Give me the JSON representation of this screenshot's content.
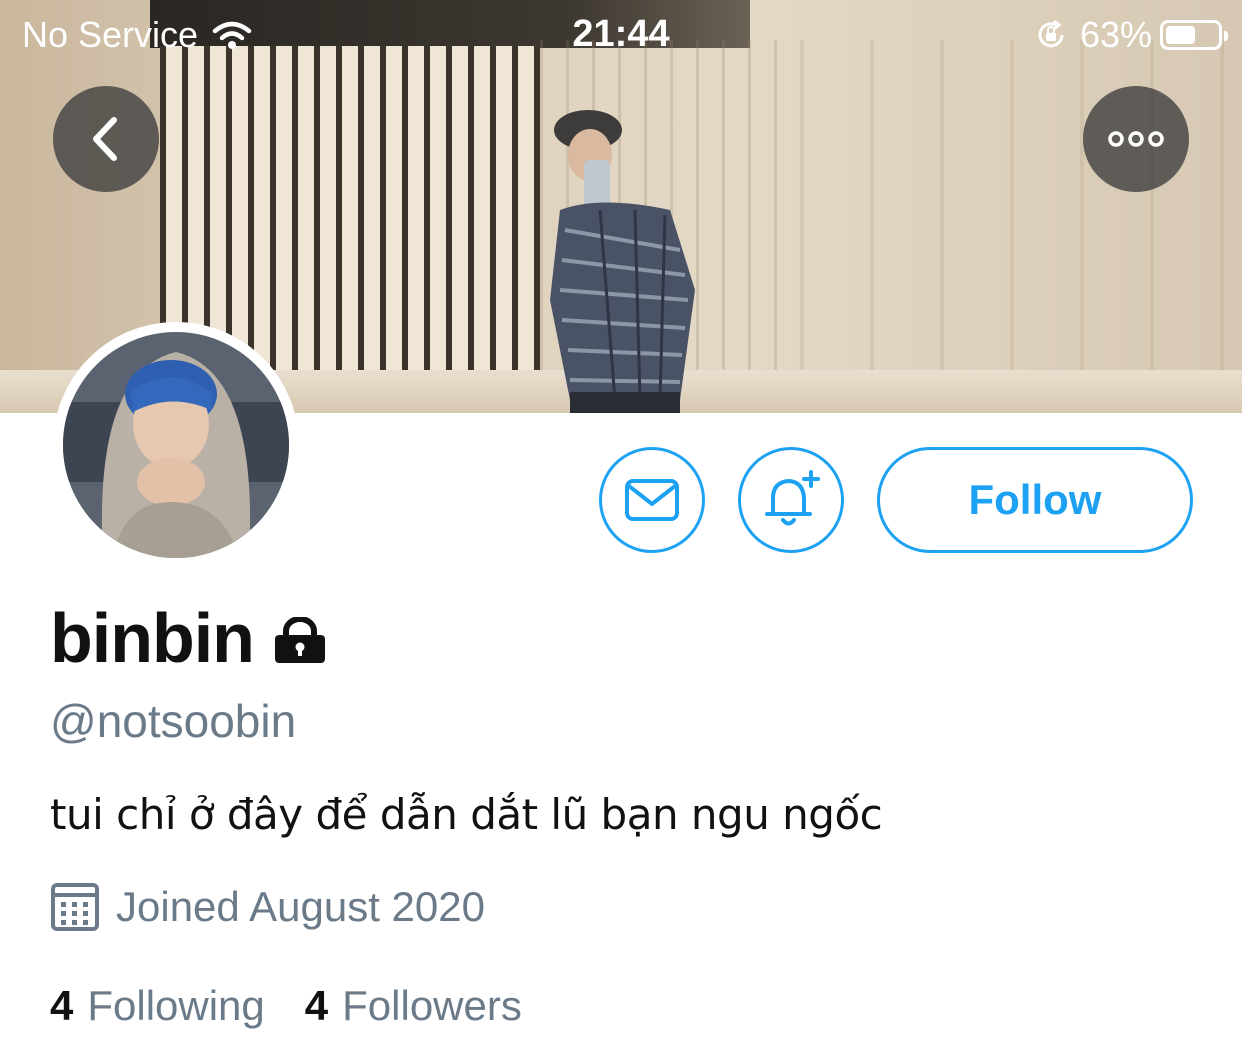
{
  "status_bar": {
    "carrier": "No Service",
    "time": "21:44",
    "battery_percent": "63%",
    "battery_level": 0.63
  },
  "nav": {
    "back_icon": "chevron-left-icon",
    "more_icon": "ellipsis-icon"
  },
  "actions": {
    "message_icon": "envelope-icon",
    "notify_icon": "bell-plus-icon",
    "follow_label": "Follow"
  },
  "profile": {
    "display_name": "binbin",
    "protected_icon": "lock-icon",
    "handle": "@notsoobin",
    "bio": "tui chỉ ở đây để dẫn dắt lũ bạn ngu ngốc",
    "joined": "Joined August 2020",
    "following_count": "4",
    "following_label": "Following",
    "followers_count": "4",
    "followers_label": "Followers"
  },
  "colors": {
    "accent": "#1da1f2",
    "secondary_text": "#6b7a88",
    "primary_text": "#111111"
  }
}
